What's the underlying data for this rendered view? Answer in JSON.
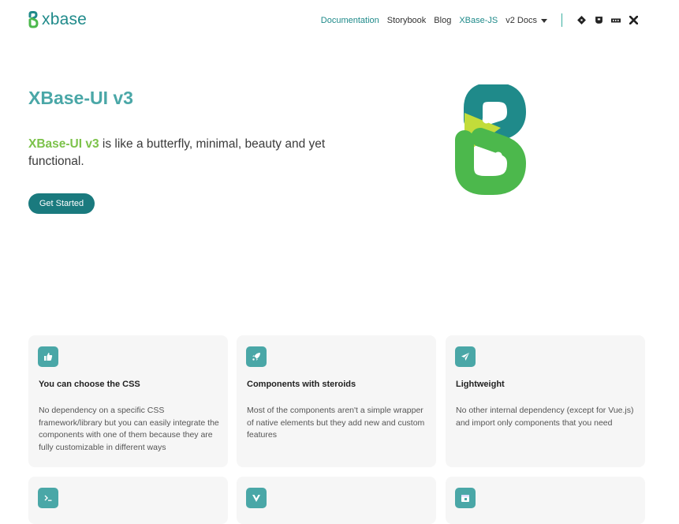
{
  "brand": {
    "name": "xbase"
  },
  "nav": {
    "links": [
      "Documentation",
      "Storybook",
      "Blog",
      "XBase-JS",
      "v2 Docs"
    ],
    "social": [
      "github-icon",
      "gitlab-icon",
      "npm-icon",
      "discord-icon"
    ]
  },
  "hero": {
    "title": "XBase-UI v3",
    "highlight": "XBase-UI v3",
    "desc": " is like a butterfly, minimal, beauty and yet functional.",
    "cta": "Get Started"
  },
  "features": [
    {
      "icon": "thumbs-up-icon",
      "title": "You can choose the CSS",
      "desc": "No dependency on a specific CSS framework/library but you can easily integrate the components with one of them because they are fully customizable in different ways"
    },
    {
      "icon": "rocket-icon",
      "title": "Components with steroids",
      "desc": "Most of the components aren't a simple wrapper of native elements but they add new and custom features"
    },
    {
      "icon": "paper-plane-icon",
      "title": "Lightweight",
      "desc": "No other internal dependency (except for Vue.js) and import only components that you need"
    },
    {
      "icon": "terminal-icon",
      "title": "",
      "desc": ""
    },
    {
      "icon": "vue-icon",
      "title": "",
      "desc": ""
    },
    {
      "icon": "calendar-icon",
      "title": "",
      "desc": ""
    }
  ],
  "colors": {
    "primary": "#1a7a7e",
    "accent": "#4aa7a7",
    "green": "#7cc24a"
  }
}
